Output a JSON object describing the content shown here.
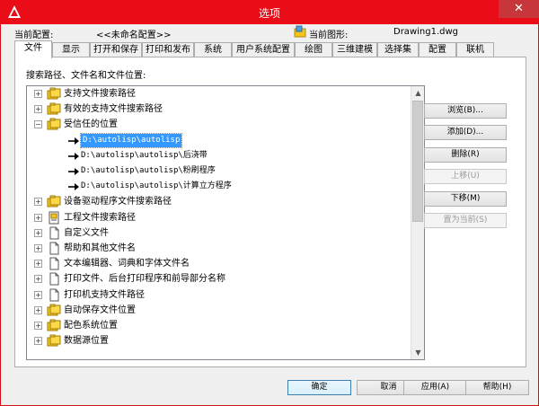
{
  "window": {
    "title": "选项",
    "close_glyph": "✕"
  },
  "header": {
    "current_profile_label": "当前配置:",
    "current_profile_value": "<<未命名配置>>",
    "current_drawing_label": "当前图形:",
    "current_drawing_value": "Drawing1.dwg"
  },
  "tabs": [
    {
      "label": "文件",
      "active": true
    },
    {
      "label": "显示"
    },
    {
      "label": "打开和保存"
    },
    {
      "label": "打印和发布"
    },
    {
      "label": "系统"
    },
    {
      "label": "用户系统配置"
    },
    {
      "label": "绘图"
    },
    {
      "label": "三维建模"
    },
    {
      "label": "选择集"
    },
    {
      "label": "配置"
    },
    {
      "label": "联机"
    }
  ],
  "panel": {
    "section_label": "搜索路径、文件名和文件位置:"
  },
  "tree": {
    "items": [
      {
        "label": "支持文件搜索路径",
        "expander": "+",
        "icon": "folder-group-icon"
      },
      {
        "label": "有效的支持文件搜索路径",
        "expander": "+",
        "icon": "folder-group-icon"
      },
      {
        "label": "受信任的位置",
        "expander": "−",
        "icon": "folder-group-icon"
      },
      {
        "label": "D:\\autolisp\\autolisp",
        "child": true,
        "selected": true,
        "icon": "arrow-right-icon"
      },
      {
        "label": "D:\\autolisp\\autolisp\\后浇带",
        "child": true,
        "icon": "arrow-right-icon"
      },
      {
        "label": "D:\\autolisp\\autolisp\\粉刷程序",
        "child": true,
        "icon": "arrow-right-icon"
      },
      {
        "label": "D:\\autolisp\\autolisp\\计算立方程序",
        "child": true,
        "icon": "arrow-right-icon"
      },
      {
        "label": "设备驱动程序文件搜索路径",
        "expander": "+",
        "icon": "folder-group-icon"
      },
      {
        "label": "工程文件搜索路径",
        "expander": "+",
        "icon": "project-file-icon"
      },
      {
        "label": "自定义文件",
        "expander": "+",
        "icon": "document-icon"
      },
      {
        "label": "帮助和其他文件名",
        "expander": "+",
        "icon": "document-icon"
      },
      {
        "label": "文本编辑器、词典和字体文件名",
        "expander": "+",
        "icon": "document-icon"
      },
      {
        "label": "打印文件、后台打印程序和前导部分名称",
        "expander": "+",
        "icon": "document-icon"
      },
      {
        "label": "打印机支持文件路径",
        "expander": "+",
        "icon": "document-icon"
      },
      {
        "label": "自动保存文件位置",
        "expander": "+",
        "icon": "folder-group-icon"
      },
      {
        "label": "配色系统位置",
        "expander": "+",
        "icon": "folder-group-icon"
      },
      {
        "label": "数据源位置",
        "expander": "+",
        "icon": "folder-group-icon"
      }
    ]
  },
  "side_buttons": {
    "browse": "浏览(B)...",
    "add": "添加(D)...",
    "delete": "删除(R)",
    "move_up": "上移(U)",
    "move_down": "下移(M)",
    "set_current": "置为当前(S)"
  },
  "footer": {
    "ok": "确定",
    "cancel": "取消",
    "apply": "应用(A)",
    "help": "帮助(H)"
  },
  "colors": {
    "titlebar": "#ea0c16",
    "selection": "#3399ff",
    "folder": "#f5c518"
  }
}
